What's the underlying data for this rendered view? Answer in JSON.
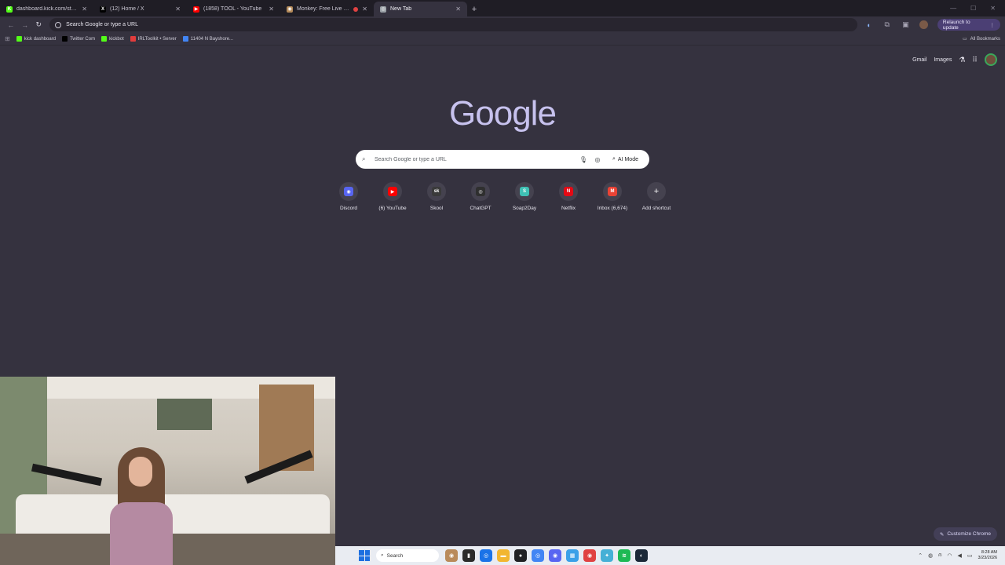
{
  "browser": {
    "tabs": [
      {
        "title": "dashboard.kick.com/stream",
        "favicon": "kick-icon",
        "color": "#53fc18",
        "glyph": "K"
      },
      {
        "title": "(12) Home / X",
        "favicon": "x-icon",
        "color": "#000000",
        "glyph": "X"
      },
      {
        "title": "(1858) TOOL - YouTube",
        "favicon": "youtube-icon",
        "color": "#ff0000",
        "glyph": "▶"
      },
      {
        "title": "Monkey: Free Live Video C",
        "favicon": "monkey-icon",
        "color": "#b58b5a",
        "glyph": "◉",
        "recording": true
      },
      {
        "title": "New Tab",
        "favicon": "chrome-icon",
        "color": "#9aa0a6",
        "glyph": "◎",
        "active": true
      }
    ],
    "new_tab_glyph": "+",
    "omnibox": {
      "text": "Search Google or type a URL"
    },
    "relaunch_label": "Relaunch to update",
    "bookmarks": [
      {
        "label": "kick dashboard",
        "color": "#53fc18"
      },
      {
        "label": "Twitter Com",
        "color": "#000000"
      },
      {
        "label": "kickbot",
        "color": "#53fc18"
      },
      {
        "label": "IRLToolkit • Server",
        "color": "#e23c3c"
      },
      {
        "label": "11404 N Bayshore...",
        "color": "#4285f4"
      }
    ],
    "all_bookmarks_label": "All Bookmarks"
  },
  "google": {
    "header_links": {
      "gmail": "Gmail",
      "images": "Images"
    },
    "logo": "Google",
    "search_placeholder": "Search Google or type a URL",
    "ai_mode_label": "AI Mode",
    "shortcuts": [
      {
        "label": "Discord",
        "color": "#5865f2",
        "glyph": "◉"
      },
      {
        "label": "(6) YouTube",
        "color": "#ff0000",
        "glyph": "▶"
      },
      {
        "label": "Skool",
        "color": "#3a3a3a",
        "glyph": "sk"
      },
      {
        "label": "ChatGPT",
        "color": "#2f2f2f",
        "glyph": "◎"
      },
      {
        "label": "Soap2Day",
        "color": "#3fc1b5",
        "glyph": "S"
      },
      {
        "label": "Netflix",
        "color": "#e50914",
        "glyph": "N"
      },
      {
        "label": "Inbox (6,674)",
        "color": "#ea4335",
        "glyph": "M"
      },
      {
        "label": "Add shortcut",
        "color": "#45424f",
        "glyph": "+"
      }
    ],
    "customize_label": "Customize Chrome"
  },
  "taskbar": {
    "search_label": "Search",
    "time": "8:28 AM",
    "date": "3/23/2026"
  }
}
